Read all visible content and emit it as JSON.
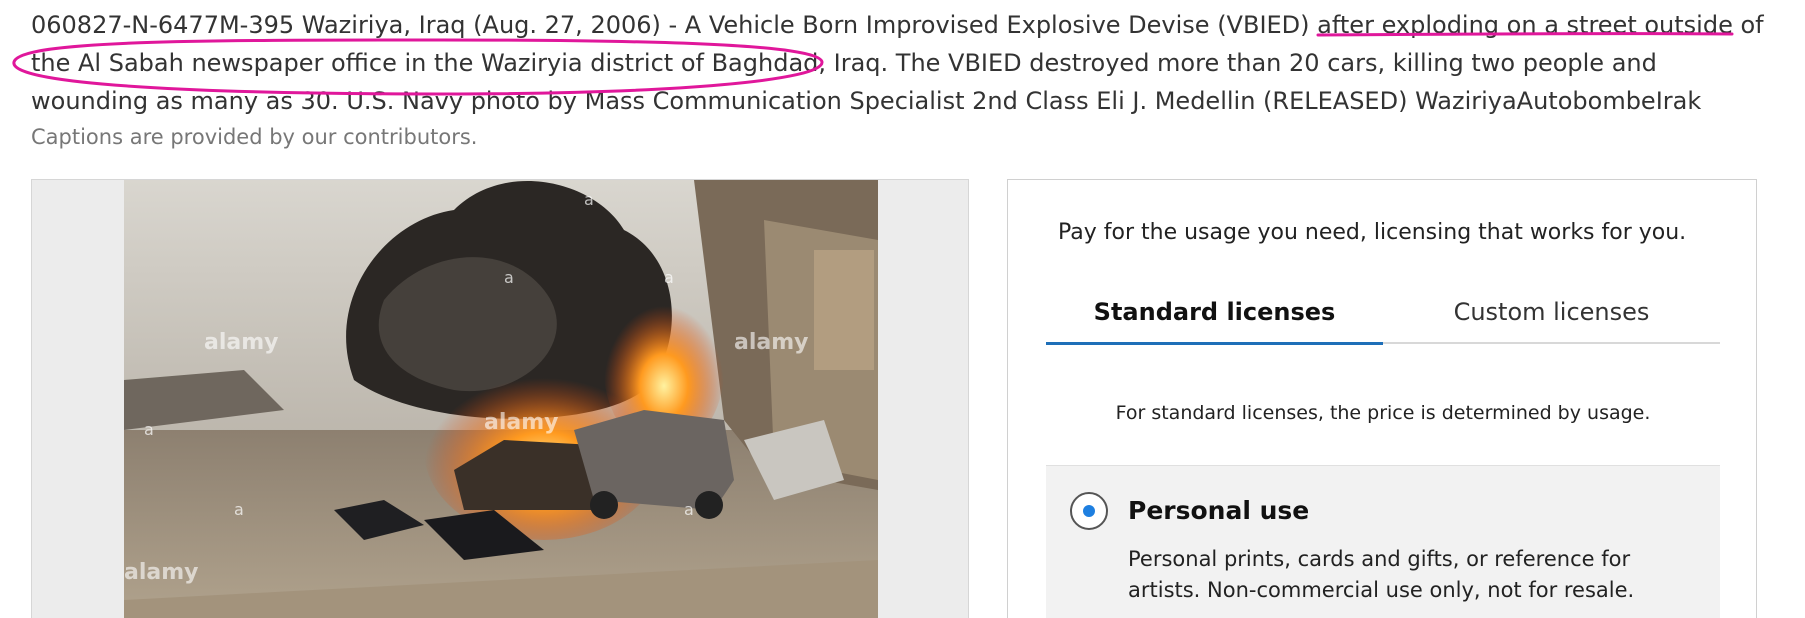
{
  "caption": {
    "text": "060827-N-6477M-395 Waziriya, Iraq (Aug. 27, 2006) - A Vehicle Born Improvised Explosive Devise (VBIED) after exploding on a street outside of the Al Sabah newspaper office in the Waziryia district of Baghdad, Iraq. The VBIED destroyed more than 20 cars, killing two people and wounding as many as 30. U.S. Navy photo by Mass Communication Specialist 2nd Class Eli J. Medellin (RELEASED) WaziriyaAutobombeIrak",
    "note": "Captions are provided by our contributors."
  },
  "photo": {
    "watermark": "alamy",
    "watermark_mark": "a"
  },
  "license": {
    "intro": "Pay for the usage you need, licensing that works for you.",
    "tabs": [
      {
        "label": "Standard licenses",
        "active": true
      },
      {
        "label": "Custom licenses",
        "active": false
      }
    ],
    "note": "For standard licenses, the price is determined by usage.",
    "option": {
      "title": "Personal use",
      "description": "Personal prints, cards and gifts, or reference for artists. Non-commercial use only, not for resale.",
      "selected": true
    }
  },
  "annotations": {
    "color": "#e0179b"
  },
  "colors": {
    "accent": "#1e6fb8",
    "radio": "#1e7fe0"
  }
}
